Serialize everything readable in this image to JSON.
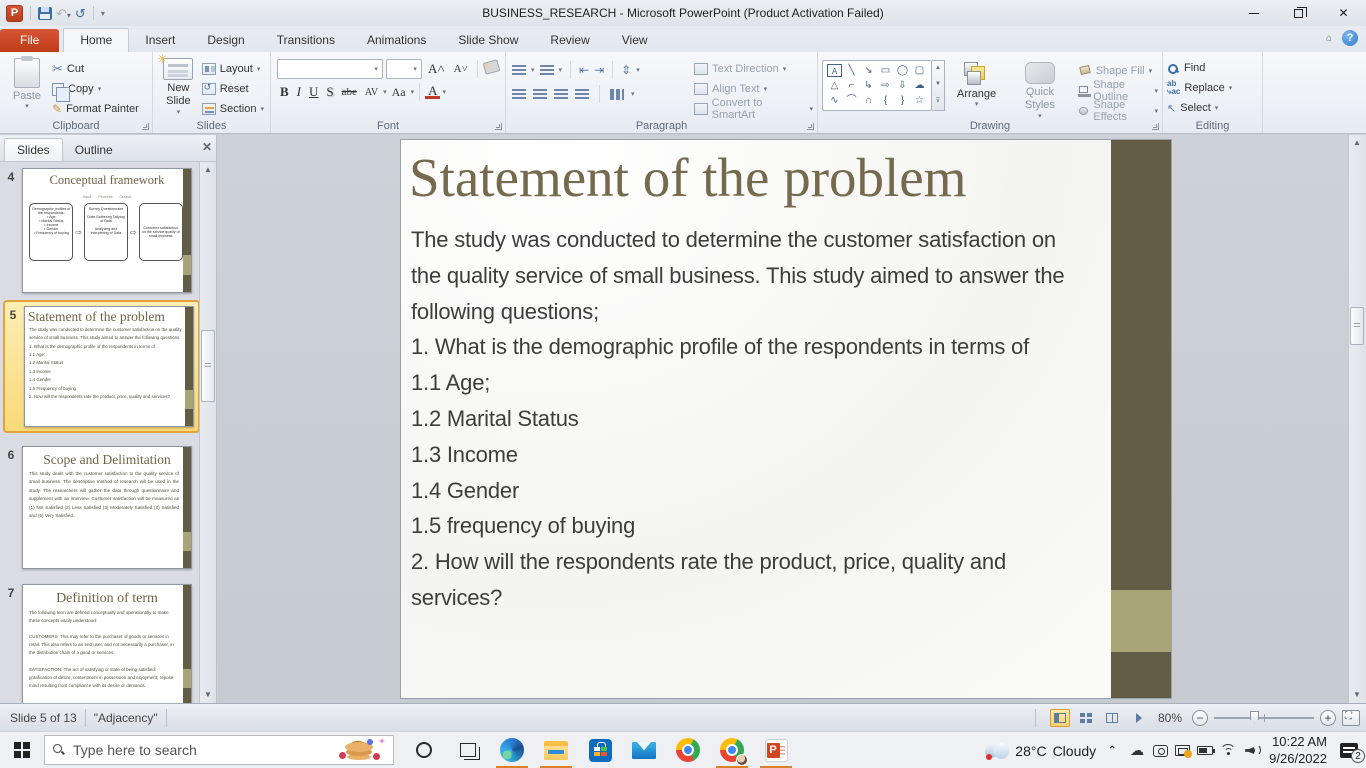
{
  "titlebar": {
    "title": "BUSINESS_RESEARCH  -  Microsoft PowerPoint (Product Activation Failed)"
  },
  "tabs": [
    "File",
    "Home",
    "Insert",
    "Design",
    "Transitions",
    "Animations",
    "Slide Show",
    "Review",
    "View"
  ],
  "ribbon": {
    "clipboard": {
      "label": "Clipboard",
      "paste": "Paste",
      "cut": "Cut",
      "copy": "Copy",
      "format_painter": "Format Painter"
    },
    "slides_group": {
      "label": "Slides",
      "new_slide": "New Slide",
      "layout": "Layout",
      "reset": "Reset",
      "section": "Section"
    },
    "font_group": {
      "label": "Font",
      "bold": "B",
      "italic": "I",
      "underline": "U",
      "strike": "S",
      "shadow": "abe",
      "spacing": "AV",
      "case": "Aa",
      "color": "A"
    },
    "paragraph_group": {
      "label": "Paragraph",
      "text_direction": "Text Direction",
      "align_text": "Align Text",
      "smartart": "Convert to SmartArt"
    },
    "drawing_group": {
      "label": "Drawing",
      "arrange": "Arrange",
      "quick_styles": "Quick Styles",
      "shape_fill": "Shape Fill",
      "shape_outline": "Shape Outline",
      "shape_effects": "Shape Effects",
      "shapes": [
        "A",
        "╲",
        "↘",
        "▭",
        "◯",
        "▢",
        "△",
        "⌐",
        "↳",
        "⇨",
        "⇩",
        "☁",
        "∿",
        "⌒",
        "∩",
        "{",
        "}",
        "☆"
      ]
    },
    "editing_group": {
      "label": "Editing",
      "find": "Find",
      "replace": "Replace",
      "select": "Select"
    }
  },
  "sidebar": {
    "tab_slides": "Slides",
    "tab_outline": "Outline",
    "slides": [
      {
        "num": "4",
        "title": "Conceptual framework",
        "headers": "Input      Process      Output",
        "box1": "Demographic profiles of the respondents:\n• Age\n• Marital Status\n• Income\n• Gender\n• Frequency of buying",
        "box2": "Survey Questionnaire\n\nData Gathering Tallying of Data\n\nAnalyzing and interpreting of Data",
        "box3": "Customer satisfaction on the service quality of small business"
      },
      {
        "num": "5",
        "title": "Statement of the problem",
        "body": "The study was conducted to determine the customer satisfaction on the quality service of small business. This study aimed to answer the following questions;\n1. What is the demographic profile of the respondents in terms of\n1.1 Age;\n1.2 Marital Status\n1.3 Income\n1.4 Gender\n1.5 Frequency of buying\n2. How will the respondents rate the product, price, quality and services?"
      },
      {
        "num": "6",
        "title": "Scope and Delimitation",
        "body": "This study deals with the customer satisfaction to the quality service of small business. The descriptive method of research will be used in the study. The researchers will gather the data through questionnaire and supplement with an interview. Customer satisfaction will be measured as (1) Not Satisfied (2) Less Satisfied (3) Moderately Satisfied (4) Satisfied and (5) Very Satisfied."
      },
      {
        "num": "7",
        "title": "Definition of term",
        "body": "The following term are defined conceptually and operationally to make these concepts easily understood:\n\nCUSTOMERS: This may refer to the purchaser of goods or services in retail. This also refers to an end user, and not necessarily a purchaser, in the distribution chain of a good or services.\n\nSATISFACTION: The act of satisfying or state of being satisfied: gratification of desire, contentment in possession and enjoyment; repose mind resulting from compliance with its desire or demands."
      }
    ]
  },
  "slide": {
    "title": "Statement of the problem",
    "body": "The study was conducted to determine the customer satisfaction on the quality service of small business. This study aimed to answer the following questions;\n1. What is the demographic profile of the respondents in terms of\n1.1 Age;\n1.2 Marital Status\n1.3 Income\n1.4 Gender\n1.5 frequency of buying\n2. How will the respondents rate the product, price, quality and services?"
  },
  "statusbar": {
    "slide_info": "Slide 5 of 13",
    "theme": "\"Adjacency\"",
    "zoom": "80%"
  },
  "taskbar": {
    "search_placeholder": "Type here to search",
    "weather_temp": "28°C",
    "weather_cond": "Cloudy",
    "time": "10:22 AM",
    "date": "9/26/2022",
    "notification_count": "2"
  }
}
